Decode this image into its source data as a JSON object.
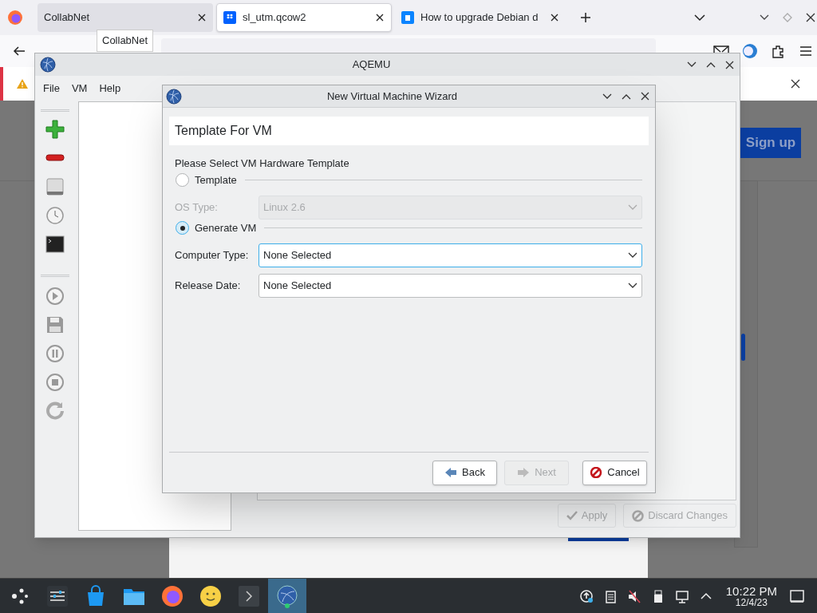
{
  "browser": {
    "tabs": [
      {
        "label": "CollabNet",
        "selected": false,
        "hovered": true
      },
      {
        "label": "sl_utm.qcow2",
        "selected": true,
        "hovered": false
      },
      {
        "label": "How to upgrade Debian d",
        "selected": false,
        "hovered": false
      }
    ],
    "tooltip": "CollabNet",
    "page_button": "Sign up"
  },
  "aqemu": {
    "title": "AQEMU",
    "menu": [
      "File",
      "VM",
      "Help"
    ],
    "buttons": [
      {
        "label": "Apply",
        "disabled": true
      },
      {
        "label": "Discard Changes",
        "disabled": true
      }
    ]
  },
  "wizard": {
    "title": "New Virtual Machine Wizard",
    "heading": "Template For VM",
    "prompt": "Please Select VM Hardware Template",
    "options": [
      {
        "label": "Template",
        "selected": false,
        "fields": [
          {
            "label": "OS Type:",
            "value": "Linux 2.6",
            "focused": false
          }
        ]
      },
      {
        "label": "Generate VM",
        "selected": true,
        "fields": [
          {
            "label": "Computer Type:",
            "value": "None Selected",
            "focused": true
          },
          {
            "label": "Release Date:",
            "value": "None Selected",
            "focused": false
          }
        ]
      }
    ],
    "buttons": [
      {
        "label": "Back",
        "disabled": false
      },
      {
        "label": "Next",
        "disabled": true
      },
      {
        "label": "Cancel",
        "disabled": false
      }
    ]
  },
  "taskbar": {
    "time": "10:22 PM",
    "date": "12/4/23"
  }
}
